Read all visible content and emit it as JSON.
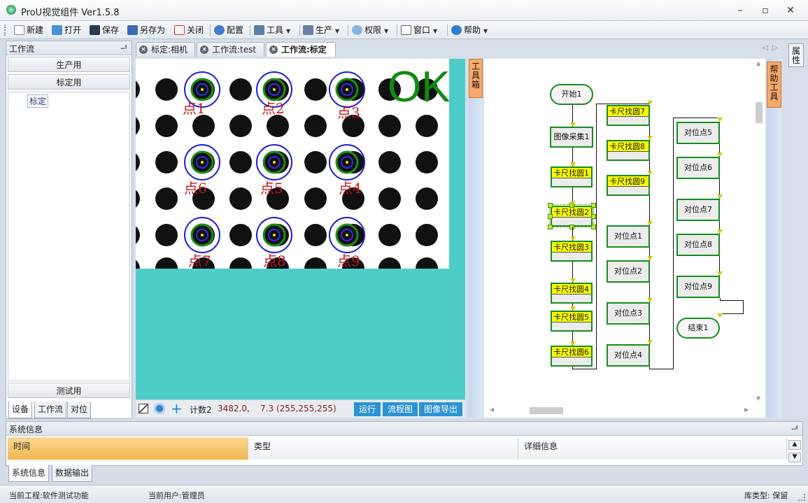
{
  "app": {
    "title": "ProU视觉组件 Ver1.5.8"
  },
  "toolbar": {
    "items": [
      {
        "label": "新建",
        "icon": "new-file-icon"
      },
      {
        "label": "打开",
        "icon": "open-folder-icon"
      },
      {
        "label": "保存",
        "icon": "save-disk-icon"
      },
      {
        "label": "另存为",
        "icon": "save-as-icon"
      },
      {
        "label": "关闭",
        "icon": "close-doc-icon"
      },
      {
        "label": "配置",
        "icon": "gear-icon"
      },
      {
        "label": "工具",
        "icon": "tools-icon"
      },
      {
        "label": "生产",
        "icon": "edit-icon"
      },
      {
        "label": "权限",
        "icon": "user-icon"
      },
      {
        "label": "窗口",
        "icon": "window-icon"
      },
      {
        "label": "帮助",
        "icon": "help-icon"
      }
    ]
  },
  "left_panel": {
    "title": "工作流",
    "pin": "ᆏ",
    "sections": [
      "生产用",
      "标定用",
      "测试用"
    ],
    "tree_item": "标定",
    "bottom_tabs": [
      "设备",
      "工作流",
      "对位"
    ]
  },
  "doc_tabs": [
    "标定:相机",
    "工作流:test",
    "工作流:标定"
  ],
  "image": {
    "status": "OK",
    "points": [
      "点1",
      "点2",
      "点3",
      "点6",
      "点5",
      "点4",
      "点7",
      "点8",
      "点9"
    ]
  },
  "image_bar": {
    "count_label": "计数2",
    "coords": "3482.0,    7.3 (255,255,255)",
    "buttons": [
      "运行",
      "流程图",
      "图像导出"
    ]
  },
  "side_tabs": {
    "toolbox": "工具箱",
    "help_tool": "帮助工具",
    "properties": "属性"
  },
  "flow": {
    "nodes": [
      "开始1",
      "图像采集1",
      "卡尺找圆1",
      "卡尺找圆2",
      "卡尺找圆3",
      "卡尺找圆4",
      "卡尺找圆5",
      "卡尺找圆6",
      "卡尺找圆7",
      "卡尺找圆8",
      "卡尺找圆9",
      "对位点1",
      "对位点2",
      "对位点3",
      "对位点4",
      "对位点5",
      "对位点6",
      "对位点7",
      "对位点8",
      "对位点9",
      "结束1"
    ]
  },
  "sys_panel": {
    "title": "系统信息",
    "columns": [
      "时间",
      "类型",
      "详细信息"
    ],
    "bottom_tabs": [
      "系统信息",
      "数据输出"
    ]
  },
  "statusbar": {
    "project": "当前工程:软件测试功能",
    "user": "当前用户:管理员",
    "lib": "库类型: 保留"
  },
  "colors": {
    "accent_blue": "#2c92d4",
    "flow_green": "#178c1f",
    "caliper_yellow": "#ffff00",
    "image_bg": "#4ecdc8",
    "ok_green": "#138a13",
    "point_red": "#c4161c"
  }
}
